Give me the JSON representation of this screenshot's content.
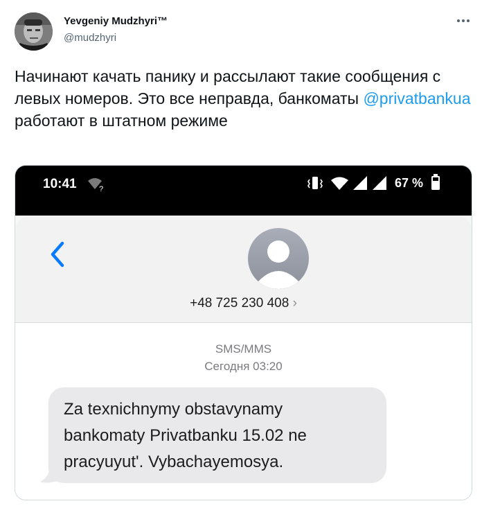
{
  "tweet": {
    "author_name": "Yevgeniy Mudzhyri™",
    "author_handle": "@mudzhyri",
    "more_icon": "more-options-icon",
    "text_before": "Начинают качать панику и рассылают такие сообщения с левых номеров. Это все неправда, банкоматы ",
    "mention": "@privatbankua",
    "text_after": " работают в штатном режиме"
  },
  "screenshot": {
    "status_bar": {
      "time": "10:41",
      "battery": "67 %",
      "icons": [
        "wifi-question-icon",
        "vibrate-icon",
        "wifi-icon",
        "signal-icon",
        "signal-icon",
        "battery-icon"
      ]
    },
    "contact": {
      "phone": "+48 725 230 408",
      "phone_chevron": "›",
      "back_icon": "chevron-left-icon",
      "avatar_icon": "contact-avatar-icon"
    },
    "message": {
      "service": "SMS/MMS",
      "date": "Сегодня 03:20",
      "text": "Za texnichnymy obstavynamy bankomaty Privatbanku 15.02 ne pracyuyut'. Vybachayemosya."
    },
    "colors": {
      "accent_link": "#1d9bf0",
      "ios_blue": "#0a7aff",
      "bubble_gray": "#e9e9eb"
    }
  }
}
